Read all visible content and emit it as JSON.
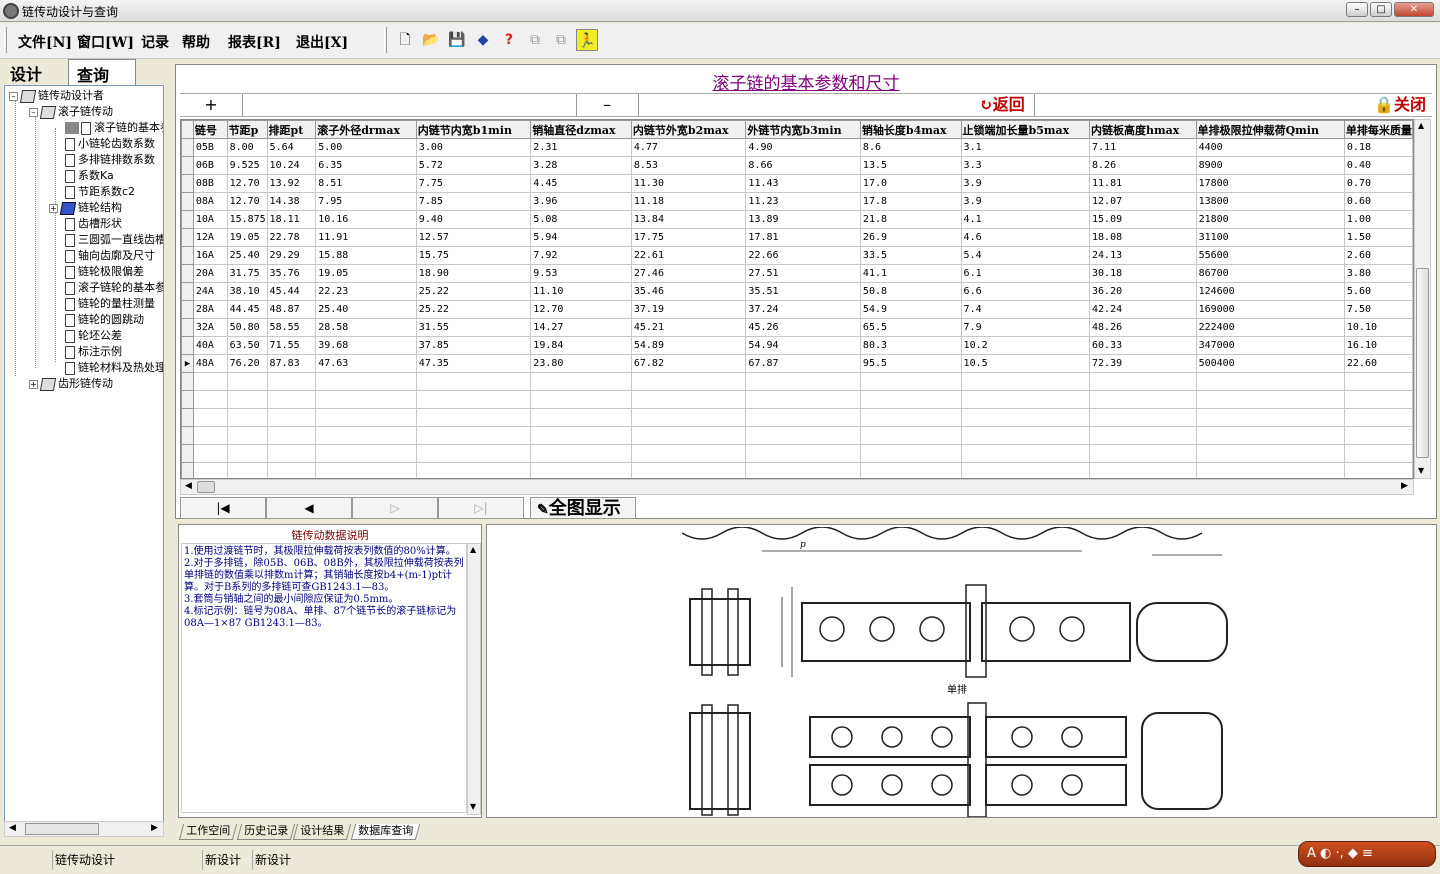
{
  "window": {
    "title": "链传动设计与查询",
    "controls": [
      "–",
      "□",
      "✕"
    ]
  },
  "menu": {
    "items": [
      "文件[N]",
      "窗口[W]",
      "记录",
      "帮助",
      "报表[R]",
      "退出[X]"
    ]
  },
  "toolbar": {
    "icons": [
      "new-icon",
      "open-icon",
      "save-icon",
      "book-icon",
      "help-icon",
      "copy-icon",
      "paste-icon",
      "runner-icon"
    ]
  },
  "left_tabs": [
    "设计",
    "查询"
  ],
  "tree": {
    "root": "链传动设计者",
    "roller": "滚子链传动",
    "children": [
      "滚子链的基本参数和尺寸",
      "小链轮齿数系数",
      "多排链排数系数",
      "系数Ka",
      "节距系数c2",
      "链轮结构",
      "齿槽形状",
      "三圆弧一直线齿槽",
      "轴向齿廓及尺寸",
      "链轮极限偏差",
      "滚子链轮的基本参数",
      "链轮的量柱测量",
      "链轮的圆跳动",
      "轮坯公差",
      "标注示例",
      "链轮材料及热处理"
    ],
    "silent": "齿形链传动"
  },
  "main": {
    "title": "滚子链的基本参数和尺寸",
    "plus_label": "+",
    "minus_label": "–",
    "back_label": "返回",
    "close_label": "关闭"
  },
  "table": {
    "headers": [
      "链号",
      "节距p",
      "排距pt",
      "滚子外径drmax",
      "内链节内宽b1min",
      "销轴直径dzmax",
      "内链节外宽b2max",
      "外链节内宽b3min",
      "销轴长度b4max",
      "止锁端加长量b5max",
      "内链板高度hmax",
      "单排极限拉伸载荷Qmin",
      "单排每米质量"
    ],
    "rows": [
      [
        "05B",
        "8.00",
        "5.64",
        "5.00",
        "3.00",
        "2.31",
        "4.77",
        "4.90",
        "8.6",
        "3.1",
        "7.11",
        "4400",
        "0.18"
      ],
      [
        "06B",
        "9.525",
        "10.24",
        "6.35",
        "5.72",
        "3.28",
        "8.53",
        "8.66",
        "13.5",
        "3.3",
        "8.26",
        "8900",
        "0.40"
      ],
      [
        "08B",
        "12.70",
        "13.92",
        "8.51",
        "7.75",
        "4.45",
        "11.30",
        "11.43",
        "17.0",
        "3.9",
        "11.81",
        "17800",
        "0.70"
      ],
      [
        "08A",
        "12.70",
        "14.38",
        "7.95",
        "7.85",
        "3.96",
        "11.18",
        "11.23",
        "17.8",
        "3.9",
        "12.07",
        "13800",
        "0.60"
      ],
      [
        "10A",
        "15.875",
        "18.11",
        "10.16",
        "9.40",
        "5.08",
        "13.84",
        "13.89",
        "21.8",
        "4.1",
        "15.09",
        "21800",
        "1.00"
      ],
      [
        "12A",
        "19.05",
        "22.78",
        "11.91",
        "12.57",
        "5.94",
        "17.75",
        "17.81",
        "26.9",
        "4.6",
        "18.08",
        "31100",
        "1.50"
      ],
      [
        "16A",
        "25.40",
        "29.29",
        "15.88",
        "15.75",
        "7.92",
        "22.61",
        "22.66",
        "33.5",
        "5.4",
        "24.13",
        "55600",
        "2.60"
      ],
      [
        "20A",
        "31.75",
        "35.76",
        "19.05",
        "18.90",
        "9.53",
        "27.46",
        "27.51",
        "41.1",
        "6.1",
        "30.18",
        "86700",
        "3.80"
      ],
      [
        "24A",
        "38.10",
        "45.44",
        "22.23",
        "25.22",
        "11.10",
        "35.46",
        "35.51",
        "50.8",
        "6.6",
        "36.20",
        "124600",
        "5.60"
      ],
      [
        "28A",
        "44.45",
        "48.87",
        "25.40",
        "25.22",
        "12.70",
        "37.19",
        "37.24",
        "54.9",
        "7.4",
        "42.24",
        "169000",
        "7.50"
      ],
      [
        "32A",
        "50.80",
        "58.55",
        "28.58",
        "31.55",
        "14.27",
        "45.21",
        "45.26",
        "65.5",
        "7.9",
        "48.26",
        "222400",
        "10.10"
      ],
      [
        "40A",
        "63.50",
        "71.55",
        "39.68",
        "37.85",
        "19.84",
        "54.89",
        "54.94",
        "80.3",
        "10.2",
        "60.33",
        "347000",
        "16.10"
      ],
      [
        "48A",
        "76.20",
        "87.83",
        "47.63",
        "47.35",
        "23.80",
        "67.82",
        "67.87",
        "95.5",
        "10.5",
        "72.39",
        "500400",
        "22.60"
      ]
    ],
    "current_row_marker": "▶"
  },
  "nav": {
    "first": "|◀",
    "prev": "◀",
    "next": "▷",
    "last": "▷|",
    "fullview": "全图显示"
  },
  "description": {
    "title": "链传动数据说明",
    "lines": [
      "1.使用过渡链节时，其极限拉伸载荷按表列数值的80%计算。",
      "2.对于多排链，除05B、06B、08B外，其极限拉伸载荷按表列单排链的数值乘以排数m计算；其销轴长度按b4+(m-1)pt计算。对于B系列的多排链可查GB1243.1—83。",
      "3.套筒与销轴之间的最小间隙应保证为0.5mm。",
      "4.标记示例：链号为08A、单排、87个链节长的滚子链标记为08A—1×87  GB1243.1—83。"
    ]
  },
  "drawing": {
    "label_single": "单排",
    "p_label": "p"
  },
  "bottom_tabs": [
    "工作空间",
    "历史记录",
    "设计结果",
    "数据库查询"
  ],
  "status": {
    "cells": [
      "链传动设计",
      "新设计",
      "新设计"
    ]
  },
  "tray_text": "A ◐ ·, ◆ ≡"
}
